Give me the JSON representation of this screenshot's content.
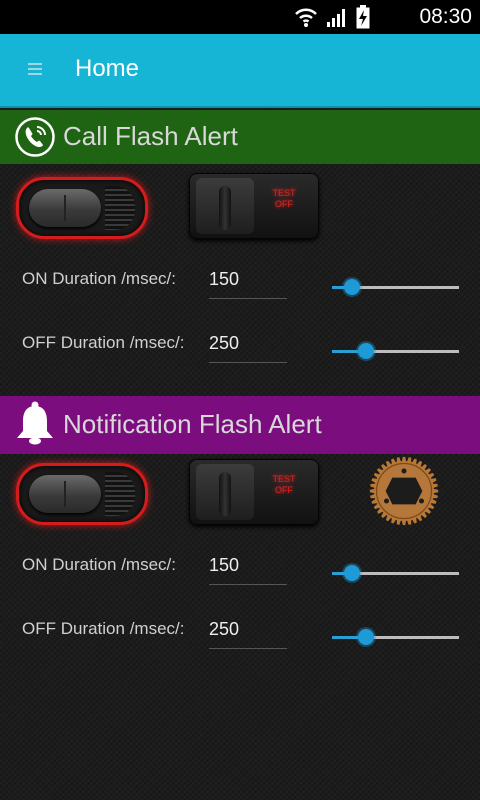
{
  "status_bar": {
    "time": "08:30",
    "icons": [
      "wifi-icon",
      "signal-icon",
      "battery-charging-icon"
    ]
  },
  "action_bar": {
    "title": "Home",
    "menu_icon": "menu-icon"
  },
  "colors": {
    "action_bar": "#16b5d5",
    "call_header": "#1e6413",
    "notification_header": "#7c0d7e",
    "slider_accent": "#1e9ad6",
    "toggle_glow": "#d51b1b"
  },
  "call_section": {
    "title": "Call Flash Alert",
    "icon": "phone-call-icon",
    "test_button": {
      "line1": "TEST",
      "line2": "OFF"
    },
    "on_duration": {
      "label": "ON Duration /msec/:",
      "value": "150",
      "slider_fraction": 0.14
    },
    "off_duration": {
      "label": "OFF Duration /msec/:",
      "value": "250",
      "slider_fraction": 0.25
    }
  },
  "notification_section": {
    "title": "Notification Flash Alert",
    "icon": "bell-icon",
    "test_button": {
      "line1": "TEST",
      "line2": "OFF"
    },
    "gear_icon": "sprocket-gear-icon",
    "on_duration": {
      "label": "ON Duration /msec/:",
      "value": "150",
      "slider_fraction": 0.14
    },
    "off_duration": {
      "label": "OFF Duration /msec/:",
      "value": "250",
      "slider_fraction": 0.25
    }
  }
}
